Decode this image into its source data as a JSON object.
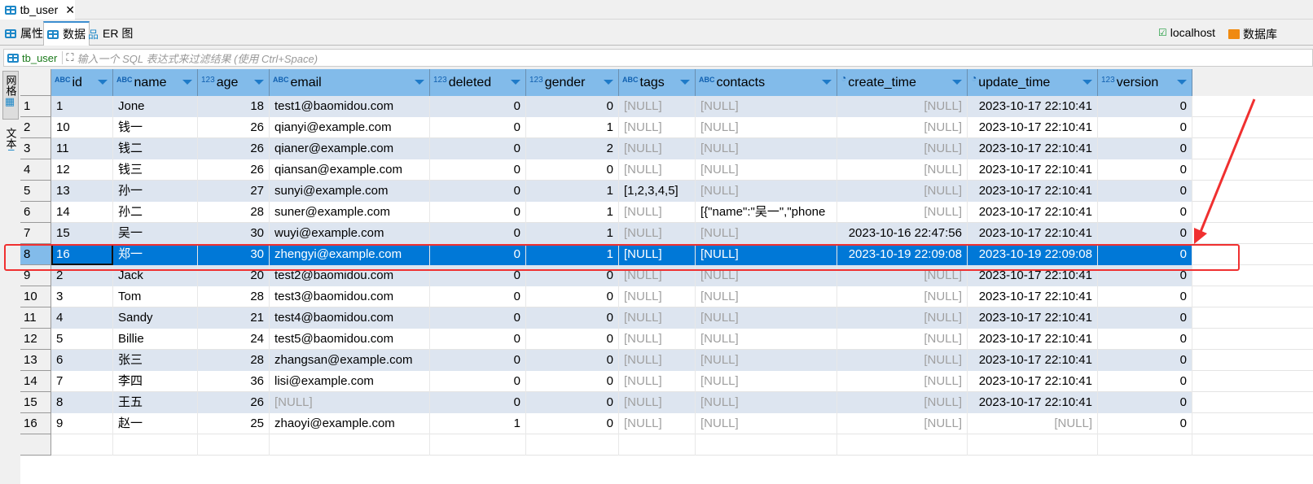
{
  "editor_tab": {
    "title": "tb_user"
  },
  "sub_tabs": [
    {
      "label": "属性"
    },
    {
      "label": "数据"
    },
    {
      "label": "ER 图"
    }
  ],
  "toolbar_right": {
    "connection": "localhost",
    "database": "数据库"
  },
  "filter": {
    "table": "tb_user",
    "placeholder": "输入一个 SQL 表达式来过滤结果 (使用 Ctrl+Space)"
  },
  "side_panels": [
    {
      "label": "网格"
    },
    {
      "label": "文本"
    }
  ],
  "columns": [
    {
      "name": "id",
      "type": "ABC"
    },
    {
      "name": "name",
      "type": "ABC"
    },
    {
      "name": "age",
      "type": "123"
    },
    {
      "name": "email",
      "type": "ABC"
    },
    {
      "name": "deleted",
      "type": "123"
    },
    {
      "name": "gender",
      "type": "123"
    },
    {
      "name": "tags",
      "type": "ABC"
    },
    {
      "name": "contacts",
      "type": "ABC"
    },
    {
      "name": "create_time",
      "type": "clock"
    },
    {
      "name": "update_time",
      "type": "clock"
    },
    {
      "name": "version",
      "type": "123"
    }
  ],
  "rows": [
    [
      "1",
      "Jone",
      "18",
      "test1@baomidou.com",
      "0",
      "0",
      "[NULL]",
      "[NULL]",
      "[NULL]",
      "2023-10-17 22:10:41",
      "0"
    ],
    [
      "10",
      "钱一",
      "26",
      "qianyi@example.com",
      "0",
      "1",
      "[NULL]",
      "[NULL]",
      "[NULL]",
      "2023-10-17 22:10:41",
      "0"
    ],
    [
      "11",
      "钱二",
      "26",
      "qianer@example.com",
      "0",
      "2",
      "[NULL]",
      "[NULL]",
      "[NULL]",
      "2023-10-17 22:10:41",
      "0"
    ],
    [
      "12",
      "钱三",
      "26",
      "qiansan@example.com",
      "0",
      "0",
      "[NULL]",
      "[NULL]",
      "[NULL]",
      "2023-10-17 22:10:41",
      "0"
    ],
    [
      "13",
      "孙一",
      "27",
      "sunyi@example.com",
      "0",
      "1",
      "[1,2,3,4,5]",
      "[NULL]",
      "[NULL]",
      "2023-10-17 22:10:41",
      "0"
    ],
    [
      "14",
      "孙二",
      "28",
      "suner@example.com",
      "0",
      "1",
      "[NULL]",
      "[{\"name\":\"吴一\",\"phone",
      "[NULL]",
      "2023-10-17 22:10:41",
      "0"
    ],
    [
      "15",
      "吴一",
      "30",
      "wuyi@example.com",
      "0",
      "1",
      "[NULL]",
      "[NULL]",
      "2023-10-16 22:47:56",
      "2023-10-17 22:10:41",
      "0"
    ],
    [
      "16",
      "郑一",
      "30",
      "zhengyi@example.com",
      "0",
      "1",
      "[NULL]",
      "[NULL]",
      "2023-10-19 22:09:08",
      "2023-10-19 22:09:08",
      "0"
    ],
    [
      "2",
      "Jack",
      "20",
      "test2@baomidou.com",
      "0",
      "0",
      "[NULL]",
      "[NULL]",
      "[NULL]",
      "2023-10-17 22:10:41",
      "0"
    ],
    [
      "3",
      "Tom",
      "28",
      "test3@baomidou.com",
      "0",
      "0",
      "[NULL]",
      "[NULL]",
      "[NULL]",
      "2023-10-17 22:10:41",
      "0"
    ],
    [
      "4",
      "Sandy",
      "21",
      "test4@baomidou.com",
      "0",
      "0",
      "[NULL]",
      "[NULL]",
      "[NULL]",
      "2023-10-17 22:10:41",
      "0"
    ],
    [
      "5",
      "Billie",
      "24",
      "test5@baomidou.com",
      "0",
      "0",
      "[NULL]",
      "[NULL]",
      "[NULL]",
      "2023-10-17 22:10:41",
      "0"
    ],
    [
      "6",
      "张三",
      "28",
      "zhangsan@example.com",
      "0",
      "0",
      "[NULL]",
      "[NULL]",
      "[NULL]",
      "2023-10-17 22:10:41",
      "0"
    ],
    [
      "7",
      "李四",
      "36",
      "lisi@example.com",
      "0",
      "0",
      "[NULL]",
      "[NULL]",
      "[NULL]",
      "2023-10-17 22:10:41",
      "0"
    ],
    [
      "8",
      "王五",
      "26",
      "[NULL]",
      "0",
      "0",
      "[NULL]",
      "[NULL]",
      "[NULL]",
      "2023-10-17 22:10:41",
      "0"
    ],
    [
      "9",
      "赵一",
      "25",
      "zhaoyi@example.com",
      "1",
      "0",
      "[NULL]",
      "[NULL]",
      "[NULL]",
      "[NULL]",
      "0"
    ]
  ],
  "selected_row": 8,
  "colors": {
    "header": "#82bbea",
    "selection": "#0078d7",
    "annotation": "#f03030",
    "stripe": "#dde5f0"
  }
}
